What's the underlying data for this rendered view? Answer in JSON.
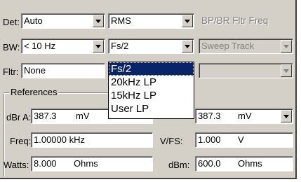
{
  "row1": {
    "det_label": "Det:",
    "det_value": "Auto",
    "mode_value": "RMS",
    "filter_title": "BP/BR Fltr Freq"
  },
  "row2": {
    "bw_label": "BW:",
    "bw_value": "< 10 Hz",
    "fs_value": "Fs/2",
    "sweep_value": "Sweep Track"
  },
  "row3": {
    "fltr_label": "Fltr:",
    "fltr_value": "None"
  },
  "dropdown": {
    "options": [
      "Fs/2",
      "20kHz LP",
      "15kHz LP",
      "User LP"
    ]
  },
  "references": {
    "title": "References",
    "dbra_label": "dBr A:",
    "dbra_value": "387.3",
    "dbra_unit": "mV",
    "right_value": "387.3",
    "right_unit": "mV",
    "freq_label": "Freq:",
    "freq_value": "1.00000 kHz",
    "vfs_label": "V/FS:",
    "vfs_value": "1.000",
    "vfs_unit": "V",
    "watts_label": "Watts:",
    "watts_value": "8.000",
    "watts_unit": "Ohms",
    "dbm_label": "dBm:",
    "dbm_value": "600.0",
    "dbm_unit": "Ohms"
  }
}
